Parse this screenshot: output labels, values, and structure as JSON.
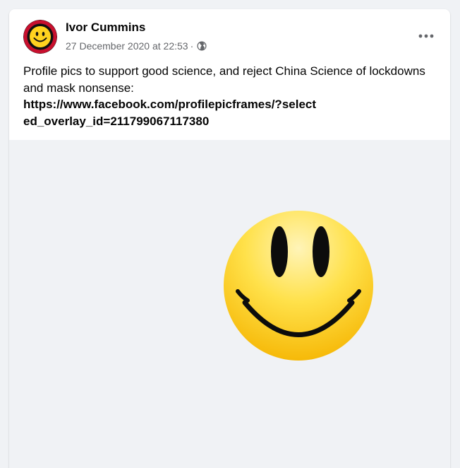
{
  "post": {
    "author": "Ivor Cummins",
    "timestamp": "27 December 2020 at 22:53",
    "separator": "·",
    "privacy_icon": "globe-icon",
    "more_icon": "more-options-icon",
    "text": "Profile pics to support good science, and reject China Science of lockdowns and mask nonsense:",
    "link": "https://www.facebook.com/profilepicframes/?selected_overlay_id=211799067117380",
    "media_icon": "smiley-face-icon"
  },
  "colors": {
    "page_background": "#f0f2f5",
    "card_background": "#ffffff",
    "primary_text": "#050505",
    "secondary_text": "#65676b",
    "smiley_yellow": "#ffd21f"
  }
}
